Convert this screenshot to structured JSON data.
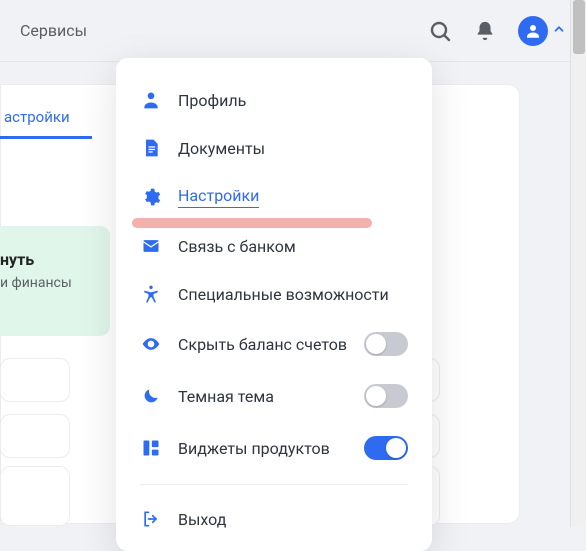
{
  "header": {
    "services_label": "Сервисы"
  },
  "tab": {
    "settings": "астройки"
  },
  "banner": {
    "line1": "нуть",
    "line2": "и финансы"
  },
  "menu": {
    "profile": "Профиль",
    "documents": "Документы",
    "settings": "Настройки",
    "contact_bank": "Связь с банком",
    "accessibility": "Специальные возможности",
    "hide_balance": "Скрыть баланс счетов",
    "dark_theme": "Темная тема",
    "product_widgets": "Виджеты продуктов",
    "logout": "Выход"
  },
  "toggles": {
    "hide_balance": false,
    "dark_theme": false,
    "product_widgets": true
  },
  "colors": {
    "accent": "#2f6bf0",
    "highlight": "#f2a9a4",
    "banner_bg": "#e1f6eb"
  }
}
